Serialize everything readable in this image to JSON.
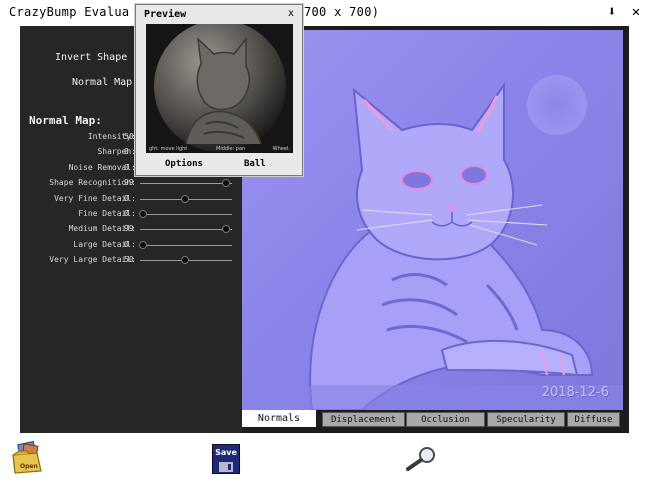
{
  "window": {
    "title": "CrazyBump Evalua",
    "title_suffix": "700 x 700)"
  },
  "panel": {
    "invert_shape_label": "Invert Shape",
    "normal_map_label": "Normal Map",
    "section_heading": "Normal Map:",
    "sliders": [
      {
        "label": "Intensity:",
        "value": "50",
        "level": 50
      },
      {
        "label": "Sharpen:",
        "value": "0",
        "level": 0
      },
      {
        "label": "Noise Removal:",
        "value": "0",
        "level": 0
      },
      {
        "label": "Shape Recognition:",
        "value": "99",
        "level": 99
      },
      {
        "label": "Very Fine Detail:",
        "value": "0",
        "level": 50
      },
      {
        "label": "Fine Detail:",
        "value": "0",
        "level": 0
      },
      {
        "label": "Medium Detail:",
        "value": "99",
        "level": 99
      },
      {
        "label": "Large Detail:",
        "value": "0",
        "level": 0
      },
      {
        "label": "Very Large Detail:",
        "value": "50",
        "level": 50
      }
    ]
  },
  "preview": {
    "title": "Preview",
    "close": "x",
    "hint_left": "ght: move light",
    "hint_mid": "Middle: pan",
    "hint_right": "Wheel:",
    "options_label": "Options",
    "ball_label": "Ball"
  },
  "image": {
    "date_stamp": "2018-12-6"
  },
  "tabs": [
    {
      "label": "Normals",
      "active": true
    },
    {
      "label": "Displacement",
      "active": false
    },
    {
      "label": "Occlusion",
      "active": false
    },
    {
      "label": "Specularity",
      "active": false
    },
    {
      "label": "Diffuse",
      "active": false
    }
  ],
  "toolbar": {
    "open_label": "Open",
    "save_label": "Save"
  },
  "colors": {
    "normal_base": "#8b84e6",
    "panel_bg": "#262626"
  }
}
